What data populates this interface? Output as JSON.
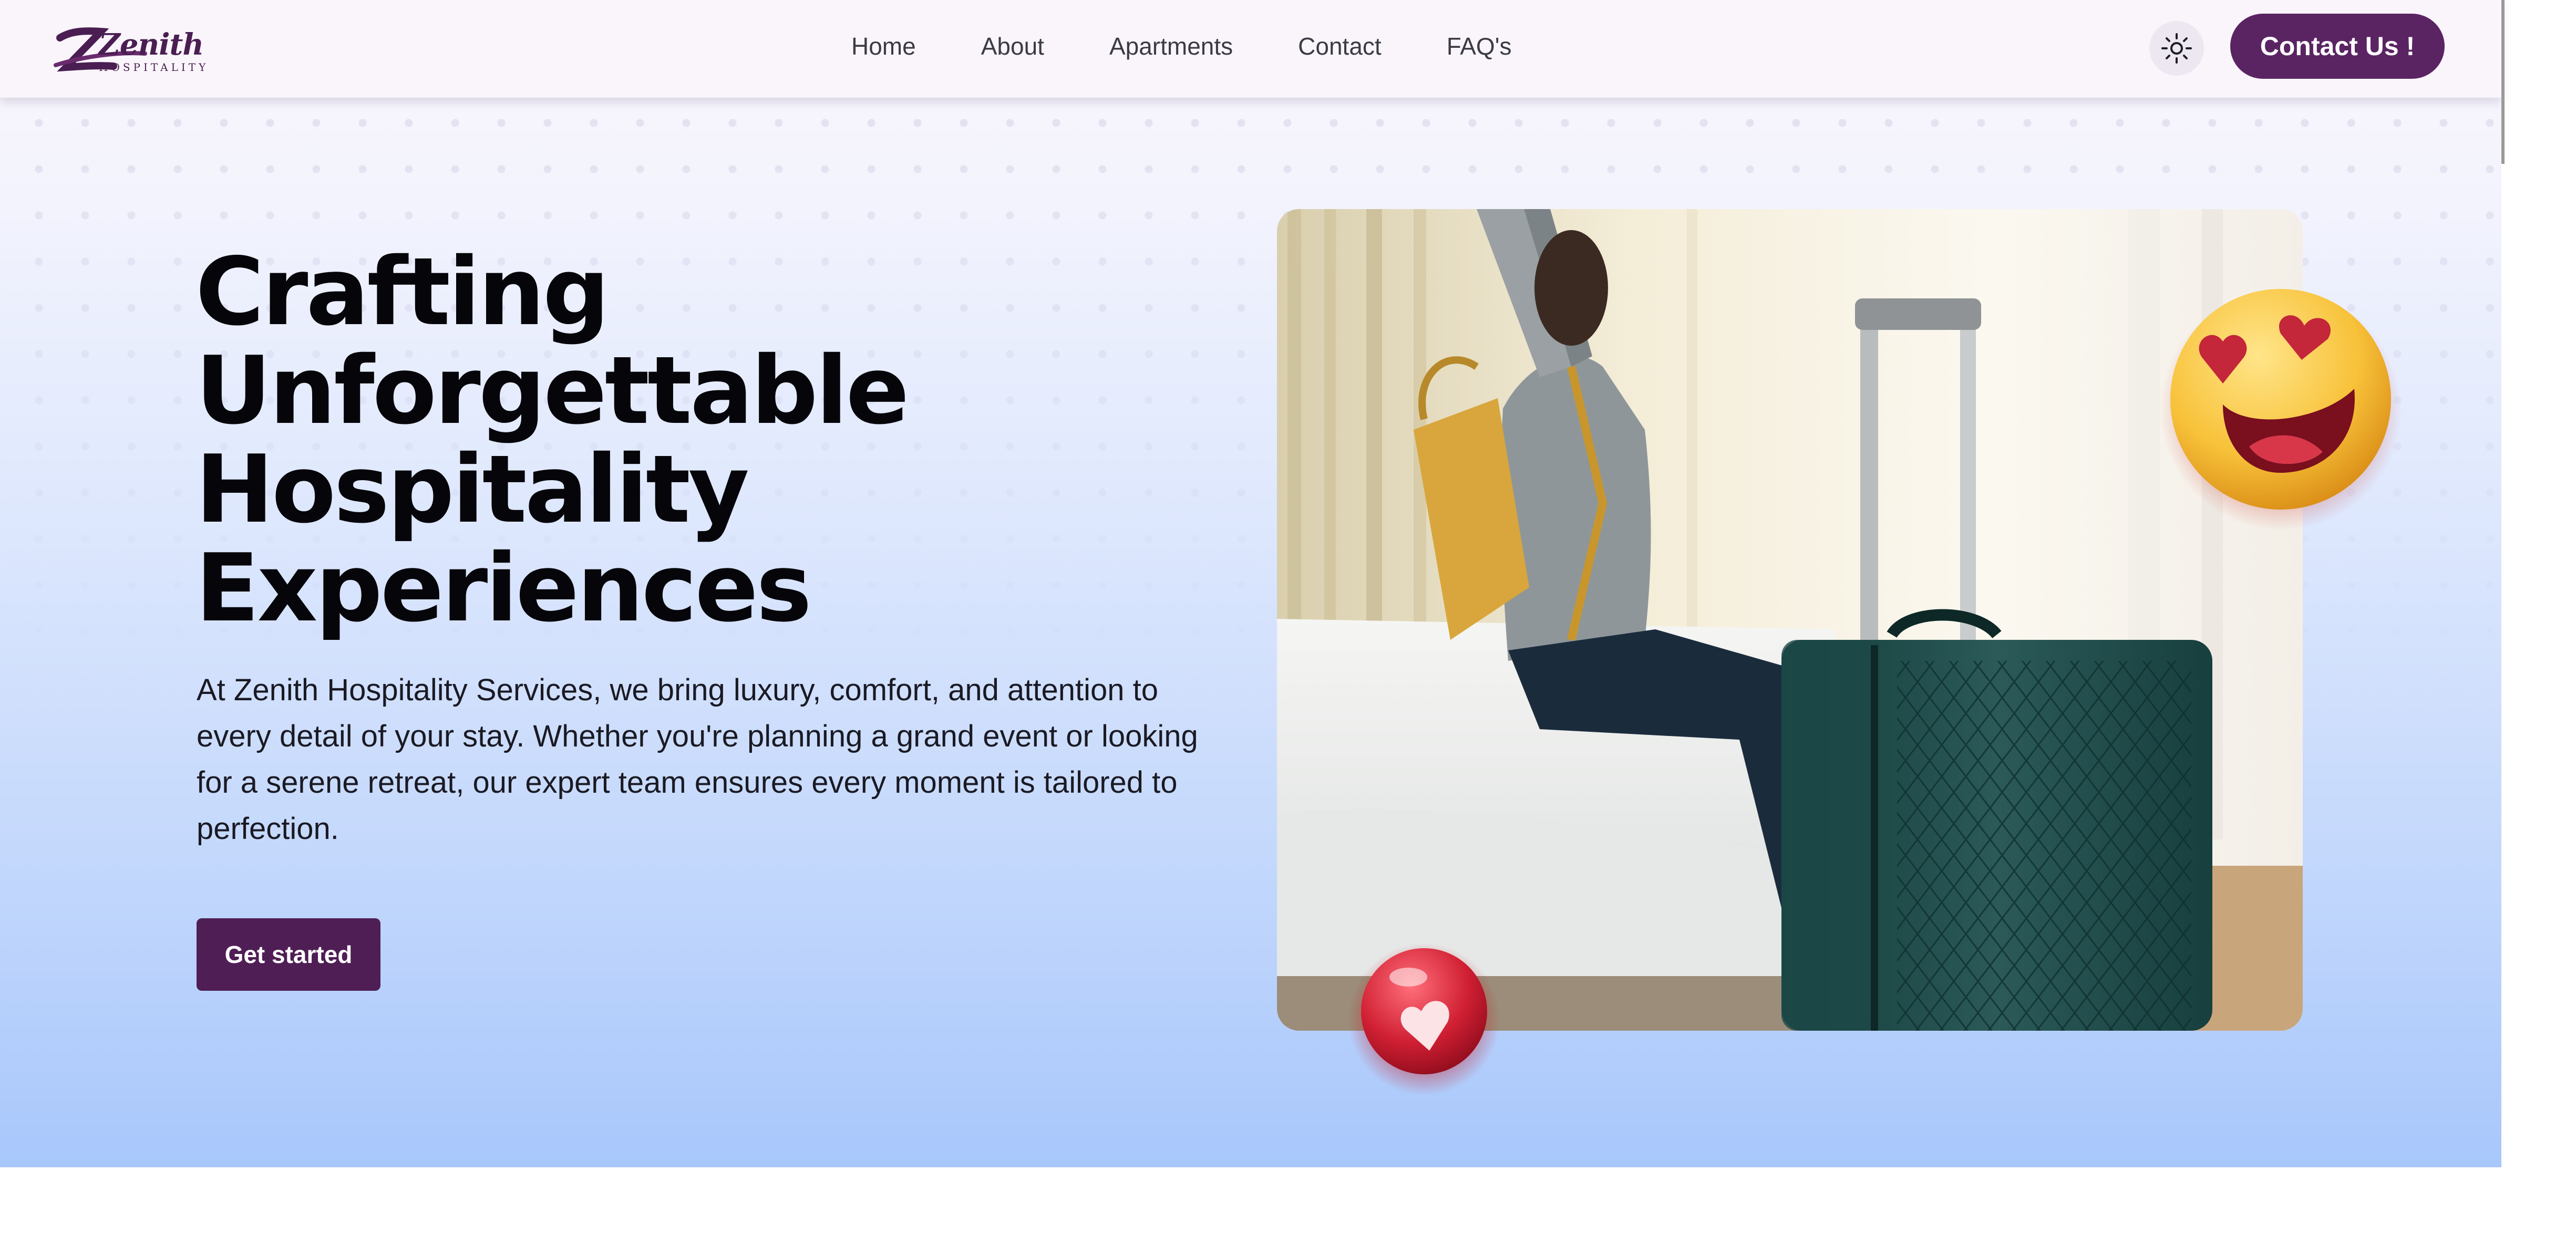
{
  "brand": {
    "name": "Zenith",
    "tagline": "HOSPITALITY",
    "logo_color": "#4a1e52"
  },
  "nav": {
    "items": [
      {
        "label": "Home"
      },
      {
        "label": "About"
      },
      {
        "label": "Apartments"
      },
      {
        "label": "Contact"
      },
      {
        "label": "FAQ's"
      }
    ]
  },
  "header": {
    "theme_toggle_icon": "sun-icon",
    "contact_label": "Contact Us !"
  },
  "hero": {
    "headline_lines": [
      "Crafting",
      "Unforgettable",
      "Hospitality",
      "Experiences"
    ],
    "lead": "At Zenith Hospitality Services, we bring luxury, comfort, and attention to every detail of your stay. Whether you're planning a grand event or looking for a serene retreat, our expert team ensures every moment is tailored to perfection.",
    "cta_label": "Get started",
    "image": "woman-with-luggage-photo",
    "decorations": [
      "heart-eyes-emoji",
      "heart-bubble-emoji"
    ]
  },
  "colors": {
    "brand_purple": "#5a2463",
    "cta_purple": "#4f1e55",
    "hero_gradient_top": "#fbf6fd",
    "hero_gradient_bottom": "#a8c7fb",
    "text_dark": "#06060a"
  }
}
